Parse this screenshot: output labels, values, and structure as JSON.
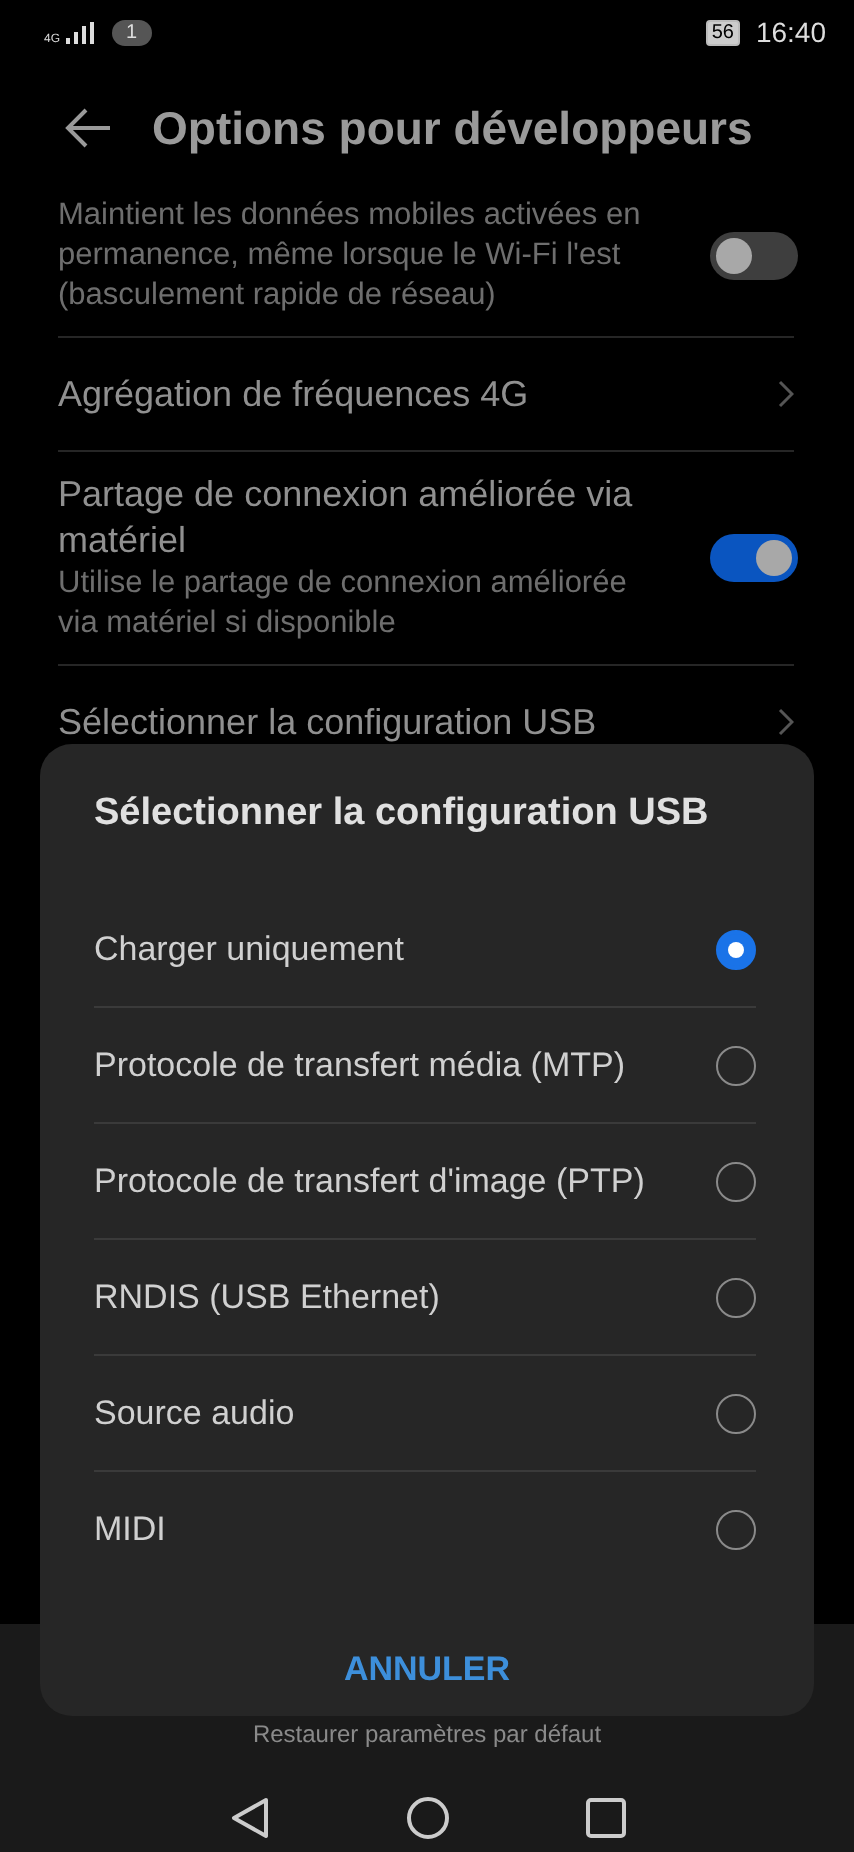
{
  "status_bar": {
    "network": "4G",
    "notification_count": "1",
    "battery": "56",
    "time": "16:40"
  },
  "header": {
    "title": "Options pour développeurs"
  },
  "settings": [
    {
      "kind": "toggle",
      "description": "Maintient les données mobiles activées en permanence, même lorsque le Wi-Fi l'est (basculement rapide de réseau)",
      "on": false
    },
    {
      "kind": "link",
      "title": "Agrégation de fréquences 4G"
    },
    {
      "kind": "toggle",
      "title": "Partage de connexion améliorée via matériel",
      "description": "Utilise le partage de connexion améliorée via matériel si disponible",
      "on": true
    },
    {
      "kind": "link",
      "title": "Sélectionner la configuration USB"
    }
  ],
  "dialog": {
    "title": "Sélectionner la configuration USB",
    "options": [
      {
        "label": "Charger uniquement",
        "selected": true
      },
      {
        "label": "Protocole de transfert média (MTP)",
        "selected": false
      },
      {
        "label": "Protocole de transfert d'image (PTP)",
        "selected": false
      },
      {
        "label": "RNDIS (USB Ethernet)",
        "selected": false
      },
      {
        "label": "Source audio",
        "selected": false
      },
      {
        "label": "MIDI",
        "selected": false
      }
    ],
    "buttons": [
      "ANNULER"
    ]
  },
  "footer": {
    "action": "Restaurer paramètres par défaut"
  }
}
